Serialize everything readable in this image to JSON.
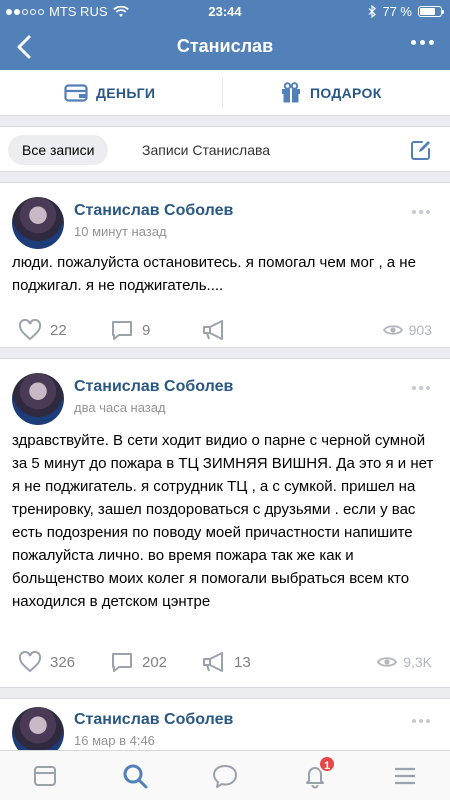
{
  "status_bar": {
    "carrier": "MTS RUS",
    "time": "23:44",
    "battery": "77 %",
    "battery_level": 0.77
  },
  "header": {
    "title": "Станислав"
  },
  "actions": {
    "money_label": "ДЕНЬГИ",
    "gift_label": "ПОДАРОК"
  },
  "filter": {
    "all_label": "Все записи",
    "own_label": "Записи Станислава"
  },
  "posts": [
    {
      "author": "Станислав Соболев",
      "time": "10 минут назад",
      "text": "люди. пожалуйста остановитесь. я помогал чем мог , а не поджигал. я не поджигатель....",
      "likes": "22",
      "comments": "9",
      "shares": "",
      "views": "903"
    },
    {
      "author": "Станислав Соболев",
      "time": "два часа назад",
      "text": "здравствуйте. В сети ходит видио о парне с черной сумной за 5 минут до пожара в ТЦ ЗИМНЯЯ ВИШНЯ. Да это я и нет я не поджигатель. я сотрудник ТЦ , а с сумкой. пришел на тренировку, зашел поздороваться с друзьями . если у вас есть подозрения по поводу моей причастности напишите пожалуйста лично. во время пожара так же как и больщенство моих колег я помогали выбраться всем кто находился в детском цэнтре",
      "likes": "326",
      "comments": "202",
      "shares": "13",
      "views": "9,3K"
    },
    {
      "author": "Станислав Соболев",
      "time": "16 мар в 4:46"
    }
  ],
  "tabbar": {
    "notifications_badge": "1"
  },
  "colors": {
    "header": "#5181b8",
    "link": "#2a5885",
    "badge": "#e64646"
  }
}
